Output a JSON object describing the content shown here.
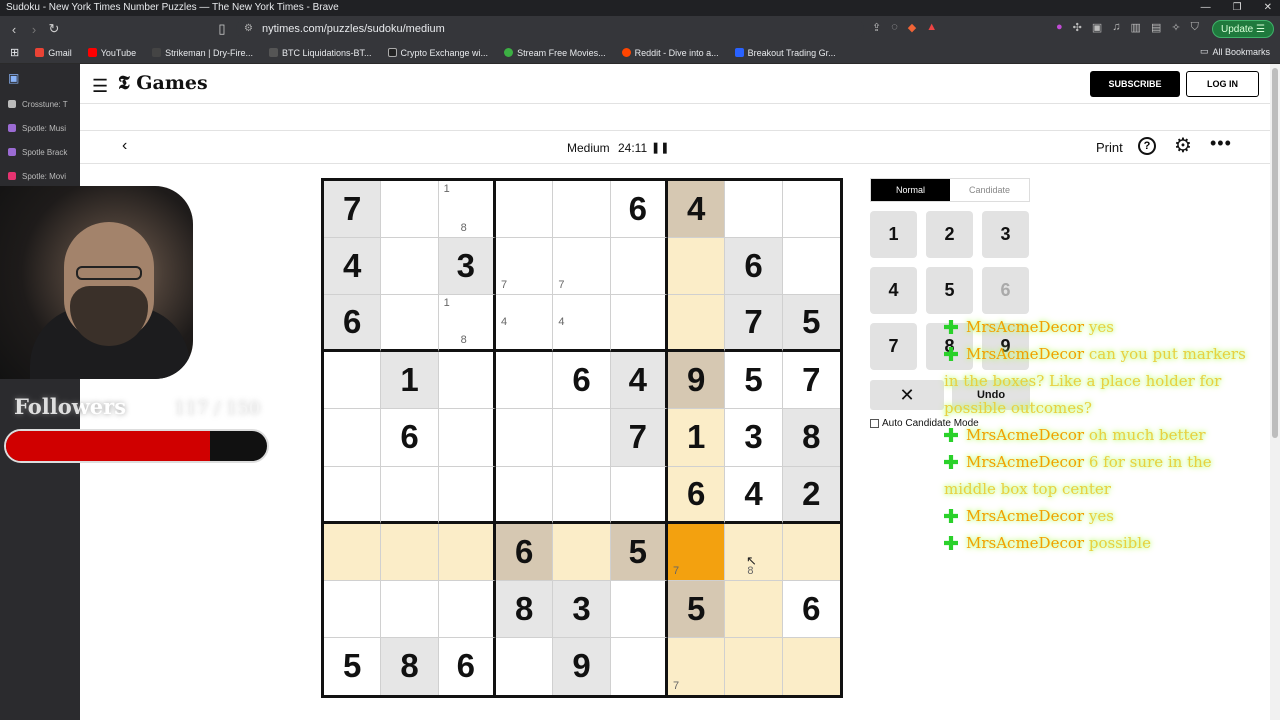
{
  "browser": {
    "title": "Sudoku - New York Times Number Puzzles — The New York Times - Brave",
    "url": "nytimes.com/puzzles/sudoku/medium",
    "update_label": "Update",
    "bookmarks": [
      "Gmail",
      "YouTube",
      "Strikeman | Dry-Fire...",
      "BTC Liquidations-BT...",
      "Crypto Exchange wi...",
      "Stream Free Movies...",
      "Reddit - Dive into a...",
      "Breakout Trading Gr..."
    ],
    "all_bookmarks": "All Bookmarks"
  },
  "sidebar": {
    "items": [
      "Crosstune: T",
      "Spotle: Musi",
      "Spotle Brack",
      "Spotle: Movi"
    ]
  },
  "stream": {
    "followers_label": "Followers",
    "followers_count": "117 / 150",
    "followers_progress": 0.78
  },
  "header": {
    "logo": "Games",
    "subscribe": "SUBSCRIBE",
    "login": "LOG IN"
  },
  "game": {
    "difficulty": "Medium",
    "timer": "24:11",
    "pause": "❚❚",
    "print": "Print",
    "help": "?"
  },
  "board": {
    "cells": [
      [
        {
          "v": "7",
          "t": "given"
        },
        {
          "v": ""
        },
        {
          "v": "",
          "c": [
            [
              "1",
              "tl"
            ],
            [
              "8",
              "bc"
            ]
          ]
        },
        {
          "v": ""
        },
        {
          "v": ""
        },
        {
          "v": "6"
        },
        {
          "v": "4",
          "t": "hlgiven"
        },
        {
          "v": ""
        },
        {
          "v": ""
        }
      ],
      [
        {
          "v": "4",
          "t": "given"
        },
        {
          "v": ""
        },
        {
          "v": "3",
          "t": "given"
        },
        {
          "v": "",
          "c": [
            [
              "7",
              "bl"
            ]
          ]
        },
        {
          "v": "",
          "c": [
            [
              "7",
              "bl"
            ]
          ]
        },
        {
          "v": ""
        },
        {
          "v": "",
          "t": "hl"
        },
        {
          "v": "6",
          "t": "given"
        },
        {
          "v": ""
        }
      ],
      [
        {
          "v": "6",
          "t": "given"
        },
        {
          "v": ""
        },
        {
          "v": "",
          "c": [
            [
              "1",
              "tl"
            ],
            [
              "8",
              "bc"
            ]
          ]
        },
        {
          "v": "",
          "c": [
            [
              "4",
              "ml"
            ]
          ]
        },
        {
          "v": "",
          "c": [
            [
              "4",
              "ml"
            ]
          ]
        },
        {
          "v": ""
        },
        {
          "v": "",
          "t": "hl"
        },
        {
          "v": "7",
          "t": "given"
        },
        {
          "v": "5",
          "t": "given"
        }
      ],
      [
        {
          "v": ""
        },
        {
          "v": "1",
          "t": "given"
        },
        {
          "v": ""
        },
        {
          "v": ""
        },
        {
          "v": "6"
        },
        {
          "v": "4",
          "t": "given"
        },
        {
          "v": "9",
          "t": "hlgiven"
        },
        {
          "v": "5"
        },
        {
          "v": "7"
        }
      ],
      [
        {
          "v": ""
        },
        {
          "v": "6"
        },
        {
          "v": ""
        },
        {
          "v": ""
        },
        {
          "v": ""
        },
        {
          "v": "7",
          "t": "given"
        },
        {
          "v": "1",
          "t": "hl"
        },
        {
          "v": "3"
        },
        {
          "v": "8",
          "t": "given"
        }
      ],
      [
        {
          "v": ""
        },
        {
          "v": ""
        },
        {
          "v": ""
        },
        {
          "v": ""
        },
        {
          "v": ""
        },
        {
          "v": ""
        },
        {
          "v": "6",
          "t": "hl"
        },
        {
          "v": "4"
        },
        {
          "v": "2",
          "t": "given"
        }
      ],
      [
        {
          "v": "",
          "t": "hl"
        },
        {
          "v": "",
          "t": "hl"
        },
        {
          "v": "",
          "t": "hl"
        },
        {
          "v": "6",
          "t": "hlgiven"
        },
        {
          "v": "",
          "t": "hl"
        },
        {
          "v": "5",
          "t": "hlgiven"
        },
        {
          "v": "",
          "t": "sel",
          "c": [
            [
              "7",
              "bl"
            ]
          ]
        },
        {
          "v": "",
          "t": "hl",
          "c": [
            [
              "8",
              "bc"
            ]
          ]
        },
        {
          "v": "",
          "t": "hl"
        }
      ],
      [
        {
          "v": ""
        },
        {
          "v": ""
        },
        {
          "v": ""
        },
        {
          "v": "8",
          "t": "given"
        },
        {
          "v": "3",
          "t": "given"
        },
        {
          "v": ""
        },
        {
          "v": "5",
          "t": "hlgiven"
        },
        {
          "v": "",
          "t": "hl"
        },
        {
          "v": "6"
        }
      ],
      [
        {
          "v": "5"
        },
        {
          "v": "8",
          "t": "given"
        },
        {
          "v": "6"
        },
        {
          "v": ""
        },
        {
          "v": "9",
          "t": "given"
        },
        {
          "v": ""
        },
        {
          "v": "",
          "t": "hl",
          "c": [
            [
              "7",
              "bl"
            ]
          ]
        },
        {
          "v": "",
          "t": "hl"
        },
        {
          "v": "",
          "t": "hl"
        }
      ]
    ]
  },
  "controls": {
    "mode_normal": "Normal",
    "mode_candidate": "Candidate",
    "numbers": [
      {
        "n": "1",
        "done": false
      },
      {
        "n": "2",
        "done": false
      },
      {
        "n": "3",
        "done": false
      },
      {
        "n": "4",
        "done": false
      },
      {
        "n": "5",
        "done": false
      },
      {
        "n": "6",
        "done": true
      },
      {
        "n": "7",
        "done": false
      },
      {
        "n": "8",
        "done": false
      },
      {
        "n": "9",
        "done": false
      }
    ],
    "erase": "✕",
    "undo": "Undo",
    "auto_candidate": "Auto Candidate Mode"
  },
  "chat": [
    {
      "user": "MrsAcmeDecor",
      "msg": "yes"
    },
    {
      "user": "MrsAcmeDecor",
      "msg": "can you put markers in the boxes? Like a place holder for possible outcomes?"
    },
    {
      "user": "MrsAcmeDecor",
      "msg": "oh much better"
    },
    {
      "user": "MrsAcmeDecor",
      "msg": "6 for sure in the middle box top center"
    },
    {
      "user": "MrsAcmeDecor",
      "msg": "yes"
    },
    {
      "user": "MrsAcmeDecor",
      "msg": "possible"
    }
  ]
}
